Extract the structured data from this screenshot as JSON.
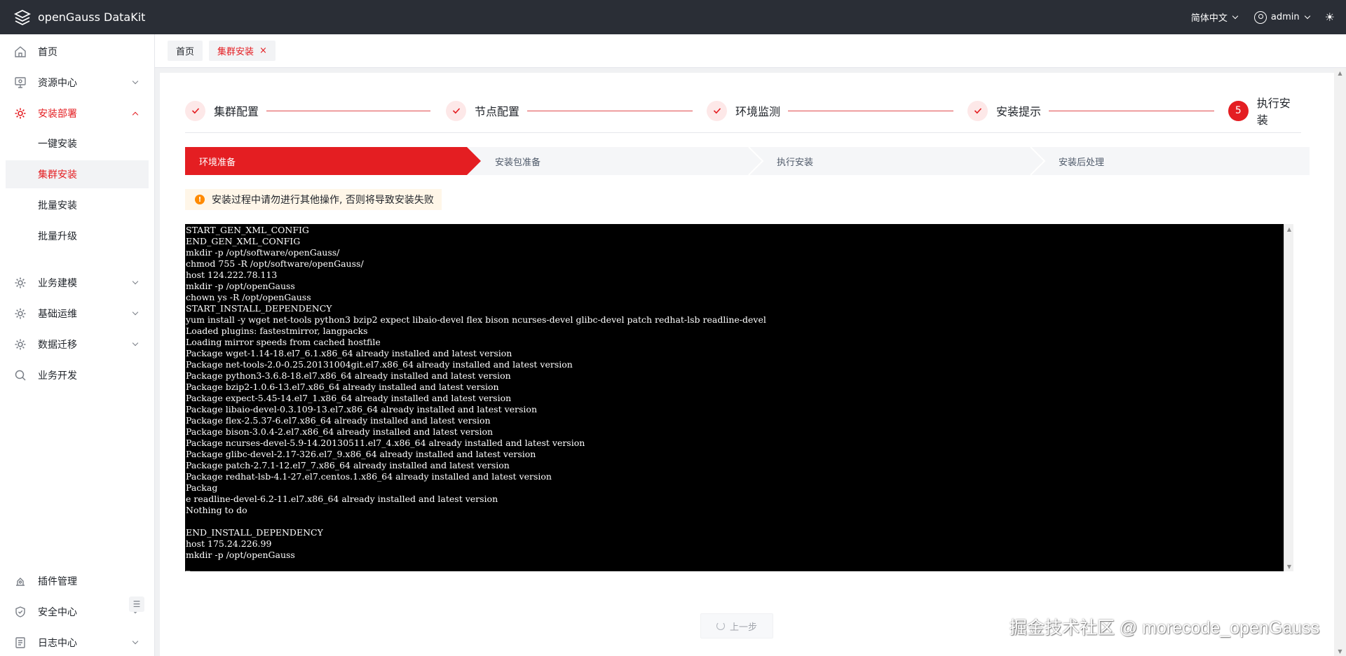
{
  "app": {
    "title": "openGauss DataKit",
    "language": "简体中文",
    "user": "admin"
  },
  "sidebar": {
    "items": [
      {
        "label": "首页",
        "icon": "home-icon"
      },
      {
        "label": "资源中心",
        "icon": "resource-icon"
      },
      {
        "label": "安装部署",
        "icon": "gear-icon"
      },
      {
        "label": "业务建模",
        "icon": "gear-icon"
      },
      {
        "label": "基础运维",
        "icon": "gear-icon"
      },
      {
        "label": "数据迁移",
        "icon": "gear-icon"
      },
      {
        "label": "业务开发",
        "icon": "search-icon"
      },
      {
        "label": "插件管理",
        "icon": "plugin-icon"
      },
      {
        "label": "安全中心",
        "icon": "shield-icon"
      },
      {
        "label": "日志中心",
        "icon": "log-icon"
      }
    ],
    "install_sub": [
      {
        "label": "一键安装"
      },
      {
        "label": "集群安装"
      },
      {
        "label": "批量安装"
      },
      {
        "label": "批量升级"
      }
    ]
  },
  "tabs": [
    {
      "label": "首页"
    },
    {
      "label": "集群安装",
      "close": "×"
    }
  ],
  "steps": [
    {
      "label": "集群配置"
    },
    {
      "label": "节点配置"
    },
    {
      "label": "环境监测"
    },
    {
      "label": "安装提示"
    },
    {
      "label": "执行安装",
      "number": "5"
    }
  ],
  "substeps": [
    {
      "label": "环境准备"
    },
    {
      "label": "安装包准备"
    },
    {
      "label": "执行安装"
    },
    {
      "label": "安装后处理"
    }
  ],
  "warning": "安装过程中请勿进行其他操作, 否则将导致安装失败",
  "terminal_lines": [
    "START_GEN_XML_CONFIG",
    "END_GEN_XML_CONFIG",
    "mkdir -p /opt/software/openGauss/",
    "chmod 755 -R /opt/software/openGauss/",
    "host 124.222.78.113",
    "mkdir -p /opt/openGauss",
    "chown ys -R /opt/openGauss",
    "START_INSTALL_DEPENDENCY",
    "yum install -y wget net-tools python3 bzip2 expect libaio-devel flex bison ncurses-devel glibc-devel patch redhat-lsb readline-devel",
    "Loaded plugins: fastestmirror, langpacks",
    "Loading mirror speeds from cached hostfile",
    "Package wget-1.14-18.el7_6.1.x86_64 already installed and latest version",
    "Package net-tools-2.0-0.25.20131004git.el7.x86_64 already installed and latest version",
    "Package python3-3.6.8-18.el7.x86_64 already installed and latest version",
    "Package bzip2-1.0.6-13.el7.x86_64 already installed and latest version",
    "Package expect-5.45-14.el7_1.x86_64 already installed and latest version",
    "Package libaio-devel-0.3.109-13.el7.x86_64 already installed and latest version",
    "Package flex-2.5.37-6.el7.x86_64 already installed and latest version",
    "Package bison-3.0.4-2.el7.x86_64 already installed and latest version",
    "Package ncurses-devel-5.9-14.20130511.el7_4.x86_64 already installed and latest version",
    "Package glibc-devel-2.17-326.el7_9.x86_64 already installed and latest version",
    "Package patch-2.7.1-12.el7_7.x86_64 already installed and latest version",
    "Package redhat-lsb-4.1-27.el7.centos.1.x86_64 already installed and latest version",
    "Packag",
    "e readline-devel-6.2-11.el7.x86_64 already installed and latest version",
    "Nothing to do",
    "",
    "END_INSTALL_DEPENDENCY",
    "host 175.24.226.99",
    "mkdir -p /opt/openGauss",
    "_"
  ],
  "prev_button": "上一步",
  "watermark": "掘金技术社区 @ morecode_openGauss",
  "colors": {
    "accent": "#e41e22",
    "topbar": "#2a2e36",
    "step_done_bg": "#fde8e8",
    "warning_bg": "#fff6e8",
    "warning_icon": "#ff8a00"
  }
}
